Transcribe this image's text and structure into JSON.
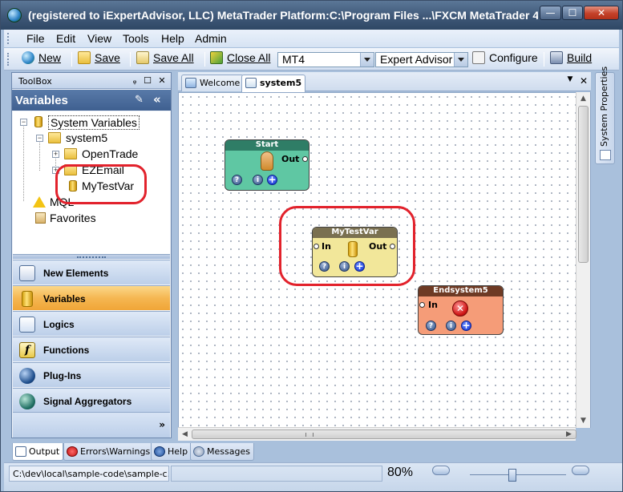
{
  "window": {
    "title": "(registered to iExpertAdvisor, LLC)  MetaTrader Platform:C:\\Program Files ...\\FXCM MetaTrader 4",
    "minimize_glyph": "—",
    "maximize_glyph": "☐",
    "close_glyph": "✕"
  },
  "menu": {
    "items": [
      "File",
      "Edit",
      "View",
      "Tools",
      "Help",
      "Admin"
    ]
  },
  "toolbar": {
    "new_label": "New",
    "save_label": "Save",
    "save_all_label": "Save All",
    "close_all_label": "Close All",
    "platform_value": "MT4",
    "project_type_value": "Expert Advisor",
    "configure_label": "Configure",
    "build_label": "Build"
  },
  "toolbox": {
    "header": "ToolBox",
    "pin_glyph": "ᵩ",
    "float_glyph": "☐",
    "close_glyph": "✕",
    "section_title": "Variables",
    "collapse_glyph": "«",
    "tree": [
      {
        "label": "System Variables"
      },
      {
        "label": "system5"
      },
      {
        "label": "OpenTrade"
      },
      {
        "label": "EZEmail"
      },
      {
        "label": "MyTestVar"
      },
      {
        "label": "MQL"
      },
      {
        "label": "Favorites"
      }
    ],
    "nav": [
      {
        "label": "New Elements"
      },
      {
        "label": "Variables"
      },
      {
        "label": "Logics"
      },
      {
        "label": "Functions"
      },
      {
        "label": "Plug-Ins"
      },
      {
        "label": "Signal Aggregators"
      }
    ],
    "more_glyph": "»"
  },
  "document": {
    "tabs": [
      {
        "label": "Welcome"
      },
      {
        "label": "system5"
      }
    ],
    "dropdown_glyph": "▼",
    "close_glyph": "✕"
  },
  "side_panel": {
    "title": "System Properties"
  },
  "nodes": {
    "start": {
      "title": "Start",
      "out": "Out",
      "color": "#5fc7a3",
      "header_color": "#2f7d66"
    },
    "mytestvar": {
      "title": "MyTestVar",
      "in": "In",
      "out": "Out",
      "color": "#f2e79a",
      "header_color": "#7a7050"
    },
    "endsystem5": {
      "title": "Endsystem5",
      "in": "In",
      "color": "#f59c78",
      "header_color": "#6e3a24"
    },
    "help_glyph": "?",
    "info_glyph": "i",
    "add_glyph": "+",
    "stop_glyph": "✕"
  },
  "bottom_tabs": [
    {
      "label": "Output"
    },
    {
      "label": "Errors\\Warnings"
    },
    {
      "label": "Help"
    },
    {
      "label": "Messages"
    }
  ],
  "status": {
    "path": "C:\\dev\\local\\sample-code\\sample-c...",
    "zoom": "80%",
    "zoom_level": 0.5
  },
  "accent_colors": {
    "title_bar": "#3f5878",
    "toolbox_header": "#3f6090",
    "active_nav": "#f5b752",
    "highlight_ring": "#e2222c"
  }
}
